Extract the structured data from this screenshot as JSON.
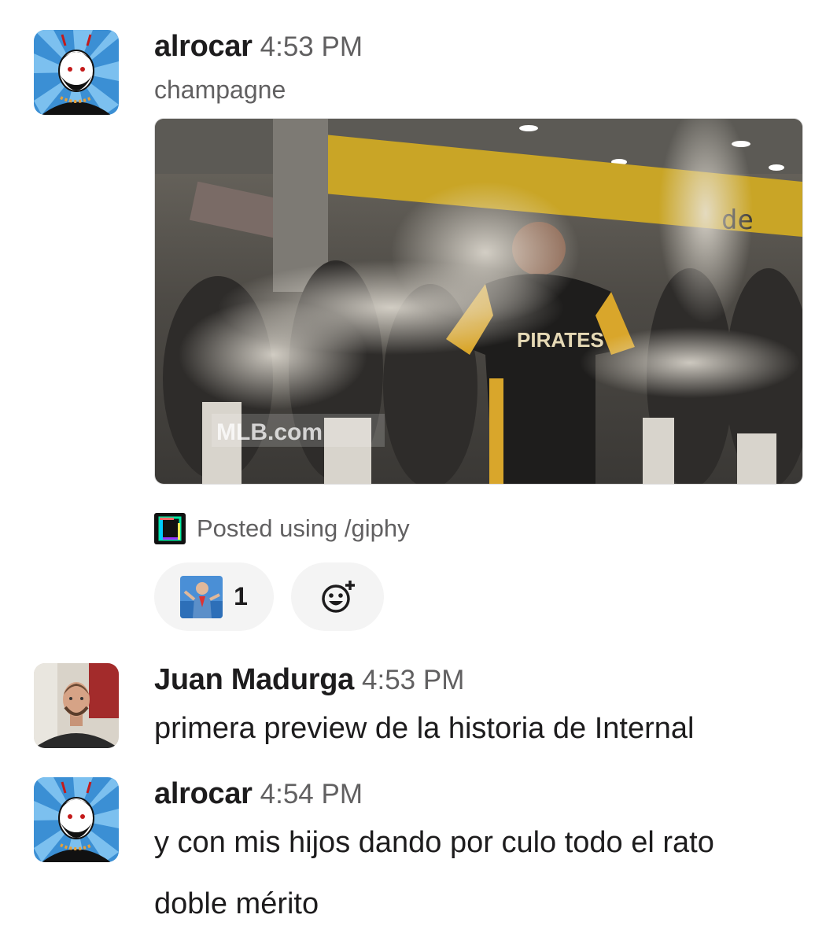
{
  "messages": [
    {
      "author": "alrocar",
      "time": "4:53 PM",
      "subtitle": "champagne",
      "attachment": {
        "type": "gif",
        "watermark": "MLB.com",
        "sign_text": "de",
        "jersey_text": "PIRATES"
      },
      "footer": {
        "icon": "giphy-icon",
        "text": "Posted using /giphy"
      },
      "reactions": [
        {
          "icon": "custom-emoji-man-photo",
          "count": "1"
        }
      ],
      "add_reaction_icon": "add-reaction-icon"
    },
    {
      "author": "Juan Madurga",
      "time": "4:53 PM",
      "lines": [
        "primera preview de la historia de Internal"
      ]
    },
    {
      "author": "alrocar",
      "time": "4:54 PM",
      "lines": [
        "y con mis hijos dando por culo todo el rato",
        "doble mérito"
      ]
    }
  ],
  "colors": {
    "author_text": "#1d1c1d",
    "meta_text": "#616061",
    "reaction_bg": "#f4f4f4",
    "avatar_blue": "#3b8fd4"
  }
}
